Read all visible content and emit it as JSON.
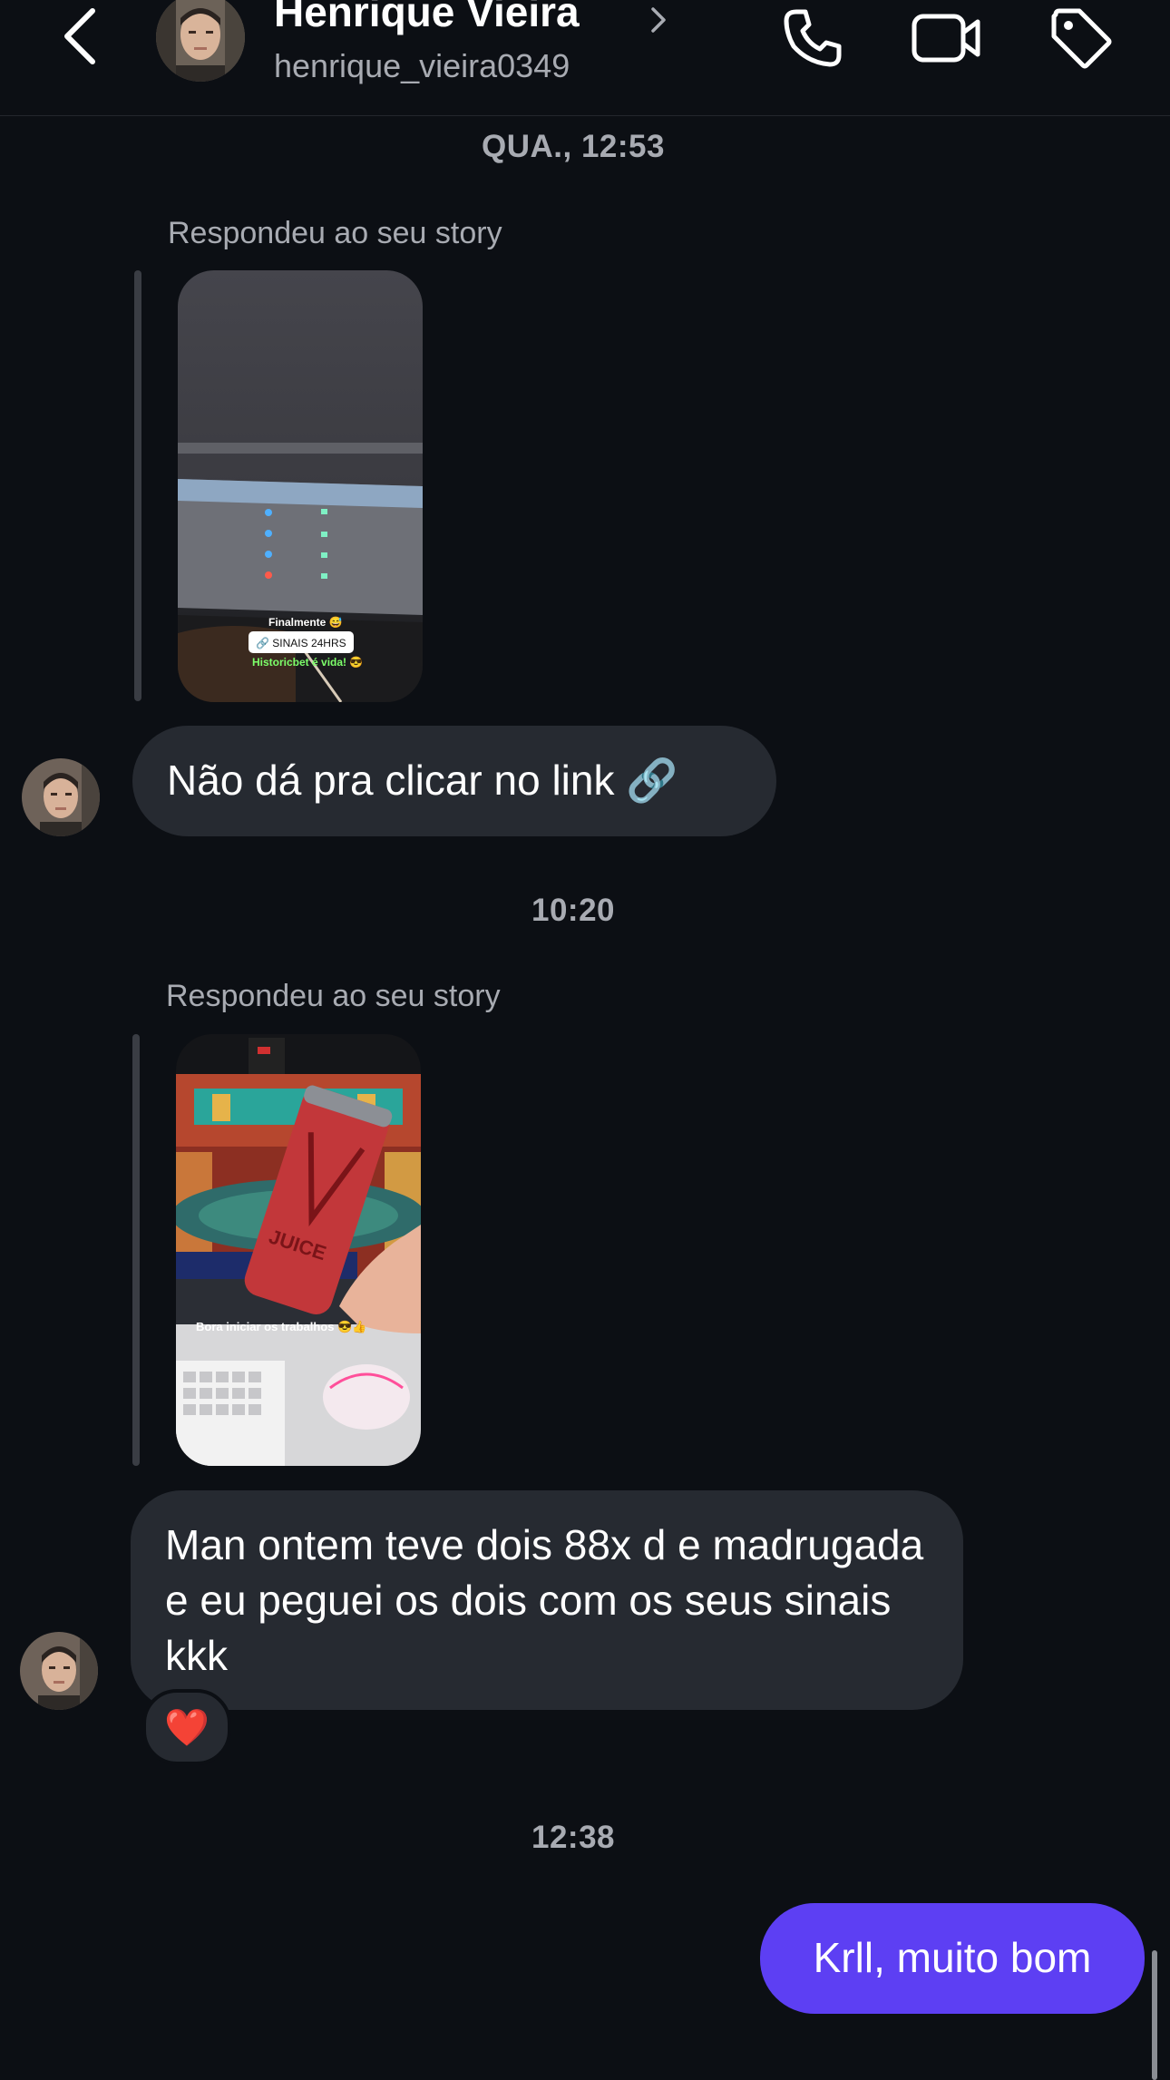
{
  "header": {
    "name": "Henrique Vieira",
    "username": "henrique_vieira0349",
    "icons": {
      "back": "back-arrow-icon",
      "chevron": "chevron-right-icon",
      "call": "phone-icon",
      "video": "video-camera-icon",
      "tag": "tag-icon"
    }
  },
  "thread": {
    "timestamp_1": "QUA., 12:53",
    "story_reply_1": {
      "label": "Respondeu ao seu story",
      "overlay_line_1": "Finalmente 😅",
      "overlay_sticker": "🔗 SINAIS 24HRS",
      "overlay_line_3": "Historicbet é vida! 😎"
    },
    "message_1": "Não dá pra clicar no link 🔗",
    "timestamp_2": "10:20",
    "story_reply_2": {
      "label": "Respondeu ao seu story",
      "overlay_caption": "Bora iniciar os trabalhos 😎👍",
      "can_text": "JUICE"
    },
    "message_2": "Man ontem teve dois 88x d e madrugada e eu peguei os dois com os seus sinais kkk",
    "message_2_reaction": "❤️",
    "timestamp_3": "12:38",
    "message_3": "Krll, muito bom"
  },
  "colors": {
    "background": "#0c0f14",
    "incoming_bubble": "#262a31",
    "outgoing_bubble": "#5d3ff3",
    "secondary_text": "#a8abb2"
  }
}
